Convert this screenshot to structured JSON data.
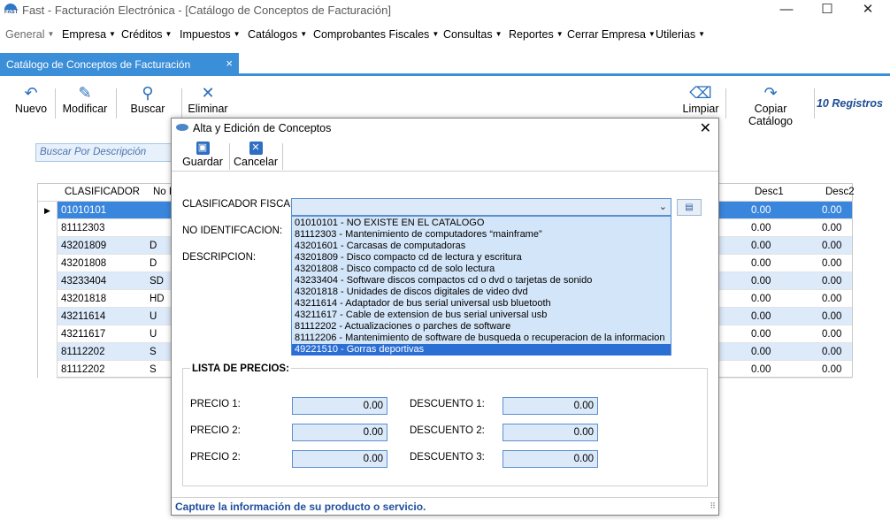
{
  "window": {
    "logo_text": "FAST",
    "title": "Fast - Facturación Electrónica - [Catálogo de Conceptos de Facturación]",
    "min": "—",
    "max": "☐",
    "close": "✕"
  },
  "menu": [
    {
      "label": "General"
    },
    {
      "label": "Empresa"
    },
    {
      "label": "Créditos"
    },
    {
      "label": "Impuestos"
    },
    {
      "label": "Catálogos"
    },
    {
      "label": "Comprobantes Fiscales"
    },
    {
      "label": "Consultas"
    },
    {
      "label": "Reportes"
    },
    {
      "label": "Cerrar Empresa"
    },
    {
      "label": "Utilerias"
    }
  ],
  "tab": {
    "label": "Catálogo de Conceptos de Facturación",
    "close": "×"
  },
  "toolbar": {
    "nuevo": "Nuevo",
    "modificar": "Modificar",
    "buscar": "Buscar",
    "eliminar": "Eliminar",
    "limpiar": "Limpiar",
    "copiar": "Copiar Catálogo",
    "registros": "10 Registros"
  },
  "search": {
    "placeholder": "Buscar Por Descripción"
  },
  "grid": {
    "headers": {
      "clasificador": "CLASIFICADOR",
      "no": "No I",
      "desc1": "Desc1",
      "desc2": "Desc2"
    },
    "rows": [
      {
        "clasificador": "01010101",
        "no": "",
        "desc1": "0.00",
        "desc2": "0.00"
      },
      {
        "clasificador": "81112303",
        "no": "",
        "desc1": "0.00",
        "desc2": "0.00"
      },
      {
        "clasificador": "43201809",
        "no": "D",
        "desc1": "0.00",
        "desc2": "0.00"
      },
      {
        "clasificador": "43201808",
        "no": "D",
        "desc1": "0.00",
        "desc2": "0.00"
      },
      {
        "clasificador": "43233404",
        "no": "SD",
        "desc1": "0.00",
        "desc2": "0.00"
      },
      {
        "clasificador": "43201818",
        "no": "HD",
        "desc1": "0.00",
        "desc2": "0.00"
      },
      {
        "clasificador": "43211614",
        "no": "U",
        "desc1": "0.00",
        "desc2": "0.00"
      },
      {
        "clasificador": "43211617",
        "no": "U",
        "desc1": "0.00",
        "desc2": "0.00"
      },
      {
        "clasificador": "81112202",
        "no": "S",
        "desc1": "0.00",
        "desc2": "0.00"
      },
      {
        "clasificador": "81112202",
        "no": "S",
        "desc1": "0.00",
        "desc2": "0.00"
      }
    ]
  },
  "dialog": {
    "title": "Alta y Edición de Conceptos",
    "close": "✕",
    "guardar": "Guardar",
    "cancelar": "Cancelar",
    "clasificador_label": "CLASIFICADOR FISCAL:",
    "no_ident_label": "NO IDENTIFCACION:",
    "descripcion_label": "DESCRIPCION:",
    "options": [
      "01010101 - NO EXISTE EN EL CATALOGO",
      "81112303 - Mantenimiento de computadores “mainframe”",
      "43201601 - Carcasas de computadoras",
      "43201809 - Disco compacto cd de lectura y escritura",
      "43201808 - Disco compacto cd de solo lectura",
      "43233404 - Software discos compactos cd o dvd o tarjetas de sonido",
      "43201818 - Unidades de discos digitales de video dvd",
      "43211614 - Adaptador de bus serial universal usb bluetooth",
      "43211617 - Cable de extension de bus serial universal usb",
      "81112202 - Actualizaciones o parches de software",
      "81112206 - Mantenimiento de software de busqueda o recuperacion de la informacion",
      "49221510 - Gorras deportivas"
    ],
    "selected_option_index": 11,
    "price_list_title": "LISTA DE PRECIOS:",
    "precio1_label": "PRECIO 1:",
    "precio2_label": "PRECIO 2:",
    "precio3_label": "PRECIO 2:",
    "descuento1_label": "DESCUENTO 1:",
    "descuento2_label": "DESCUENTO 2:",
    "descuento3_label": "DESCUENTO 3:",
    "precio1": "0.00",
    "precio2": "0.00",
    "precio3": "0.00",
    "descuento1": "0.00",
    "descuento2": "0.00",
    "descuento3": "0.00",
    "status": "Capture la información de su producto o servicio."
  },
  "colors": {
    "accent": "#3b8ed8",
    "selection": "#2b6ed4",
    "field": "#dbe9f8",
    "status_text": "#1f4e9c"
  }
}
